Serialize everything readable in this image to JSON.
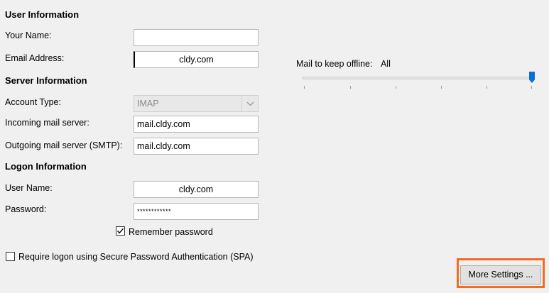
{
  "user_info": {
    "title": "User Information",
    "name_label": "Your Name:",
    "name_value": "",
    "email_label": "Email Address:",
    "email_value": "cldy.com"
  },
  "server_info": {
    "title": "Server Information",
    "account_type_label": "Account Type:",
    "account_type_value": "IMAP",
    "incoming_label": "Incoming mail server:",
    "incoming_value": "mail.cldy.com",
    "outgoing_label": "Outgoing mail server (SMTP):",
    "outgoing_value": "mail.cldy.com"
  },
  "logon_info": {
    "title": "Logon Information",
    "username_label": "User Name:",
    "username_value": "cldy.com",
    "password_label": "Password:",
    "password_value": "************",
    "remember_label": "Remember password",
    "remember_checked": true,
    "spa_label": "Require logon using Secure Password Authentication (SPA)",
    "spa_checked": false
  },
  "offline": {
    "label": "Mail to keep offline:",
    "value": "All",
    "slider_fraction": 1.0
  },
  "buttons": {
    "more_settings": "More Settings ..."
  },
  "colors": {
    "highlight": "#f26b21",
    "slider_thumb": "#0a6fd6"
  }
}
